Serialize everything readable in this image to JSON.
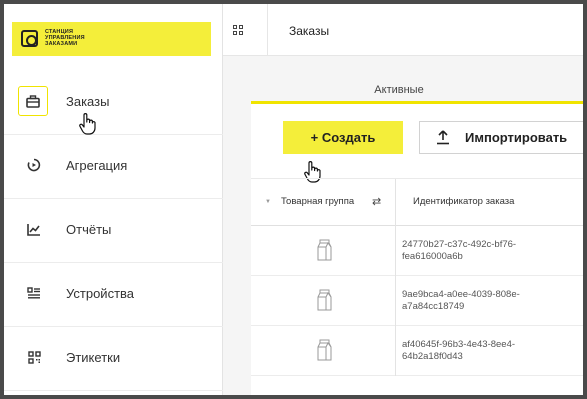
{
  "logo": {
    "lines": [
      "СТАНЦИЯ",
      "УПРАВЛЕНИЯ",
      "ЗАКАЗАМИ"
    ]
  },
  "sidebar": {
    "items": [
      {
        "label": "Заказы",
        "icon": "briefcase-icon",
        "active": true
      },
      {
        "label": "Агрегация",
        "icon": "aggregation-icon",
        "active": false
      },
      {
        "label": "Отчёты",
        "icon": "chart-icon",
        "active": false
      },
      {
        "label": "Устройства",
        "icon": "device-icon",
        "active": false
      },
      {
        "label": "Этикетки",
        "icon": "qr-icon",
        "active": false
      }
    ]
  },
  "header": {
    "title": "Заказы"
  },
  "tabs": {
    "active_label": "Активные"
  },
  "toolbar": {
    "create_label": "+   Создать",
    "import_label": "Импортировать"
  },
  "table": {
    "columns": [
      "Товарная группа",
      "Идентификатор заказа"
    ],
    "rows": [
      {
        "product_group_icon": "milk-carton-icon",
        "order_id": "24770b27-c37c-492c-bf76-fea616000a6b"
      },
      {
        "product_group_icon": "milk-carton-icon",
        "order_id": "9ae9bca4-a0ee-4039-808e-a7a84cc18749"
      },
      {
        "product_group_icon": "milk-carton-icon",
        "order_id": "af40645f-96b3-4e43-8ee4-64b2a18f0d43"
      }
    ]
  },
  "colors": {
    "accent": "#f4ee3a",
    "frame": "#4a4a4a"
  }
}
